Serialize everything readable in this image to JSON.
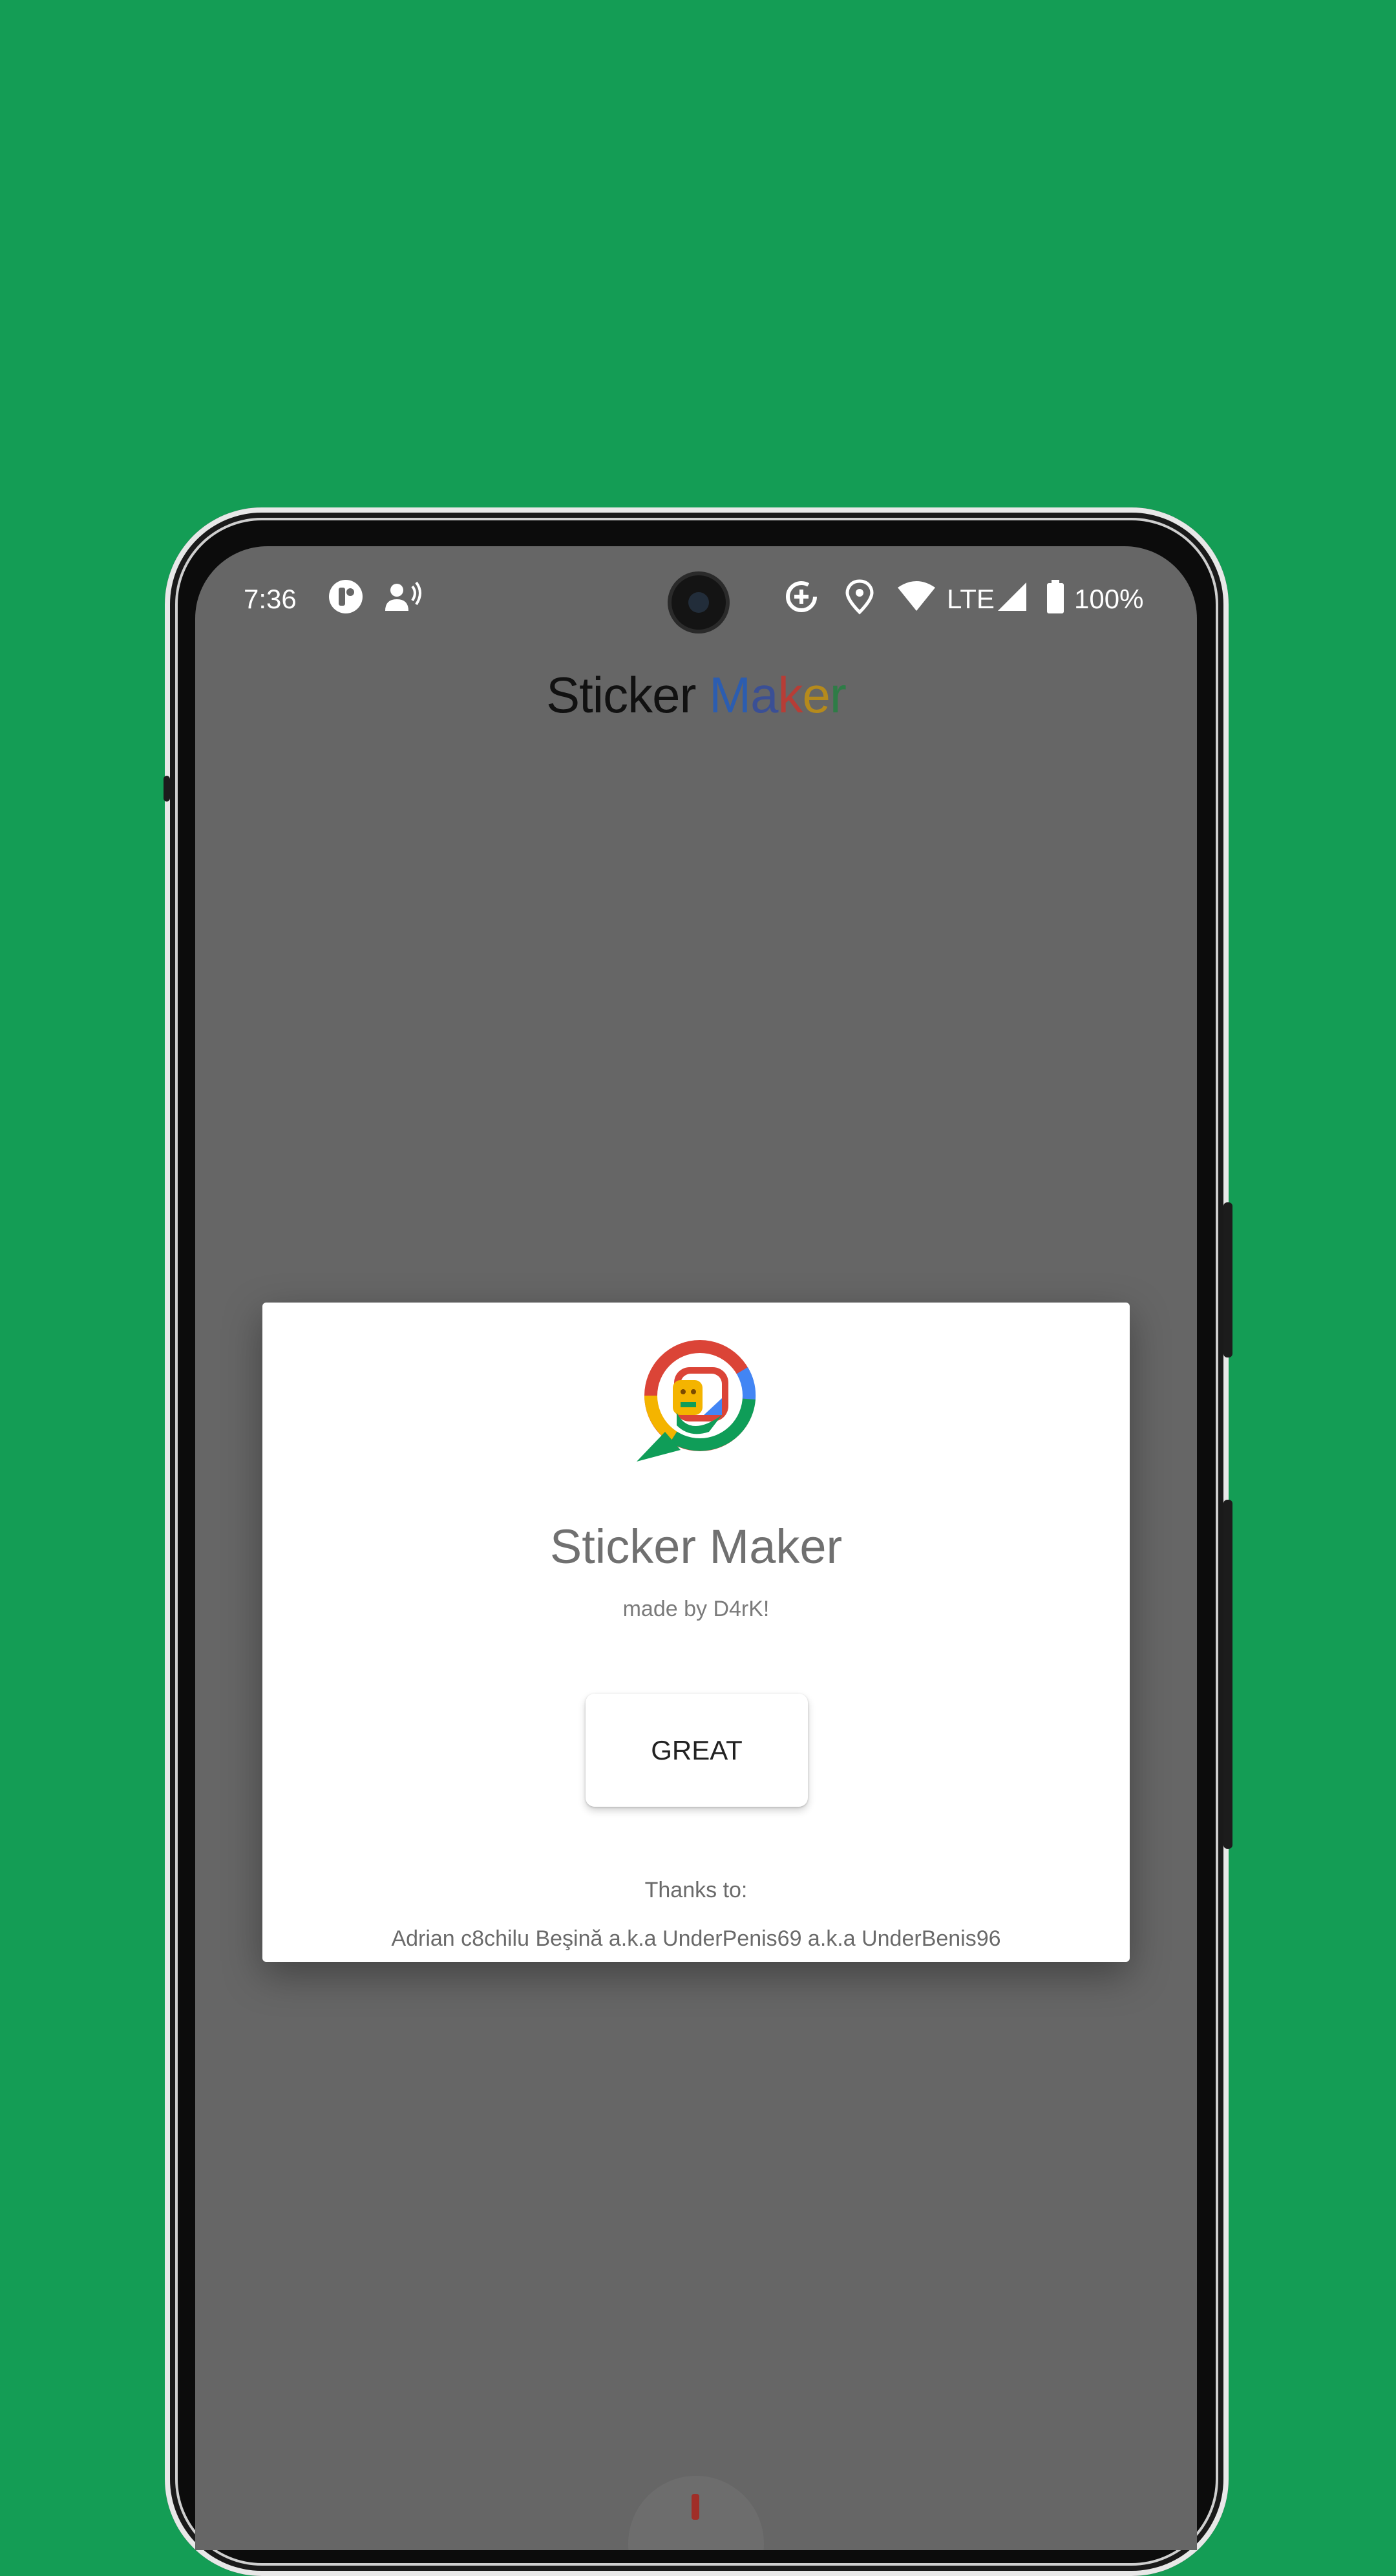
{
  "status_bar": {
    "time": "7:36",
    "network": "LTE",
    "battery": "100%",
    "icons": [
      "app-notification-icon",
      "voice-assistant-icon",
      "data-saver-icon",
      "location-icon",
      "wifi-icon",
      "cell-signal-icon",
      "battery-icon"
    ]
  },
  "app": {
    "title_word1": "Sticker",
    "title_word2_letters": [
      "M",
      "a",
      "k",
      "e",
      "r"
    ]
  },
  "dialog": {
    "title": "Sticker Maker",
    "subtitle": "made by D4rK!",
    "button_label": "GREAT",
    "thanks_label": "Thanks to:",
    "thanks_names": "Adrian c8chilu Beşină a.k.a UnderPenis69 a.k.a UnderBenis96"
  },
  "colors": {
    "background": "#149d55",
    "scrim": "#666666",
    "dialog": "#ffffff",
    "logo_red": "#db4437",
    "logo_yellow": "#f4b400",
    "logo_green": "#0f9d58",
    "logo_blue": "#4285f4"
  }
}
